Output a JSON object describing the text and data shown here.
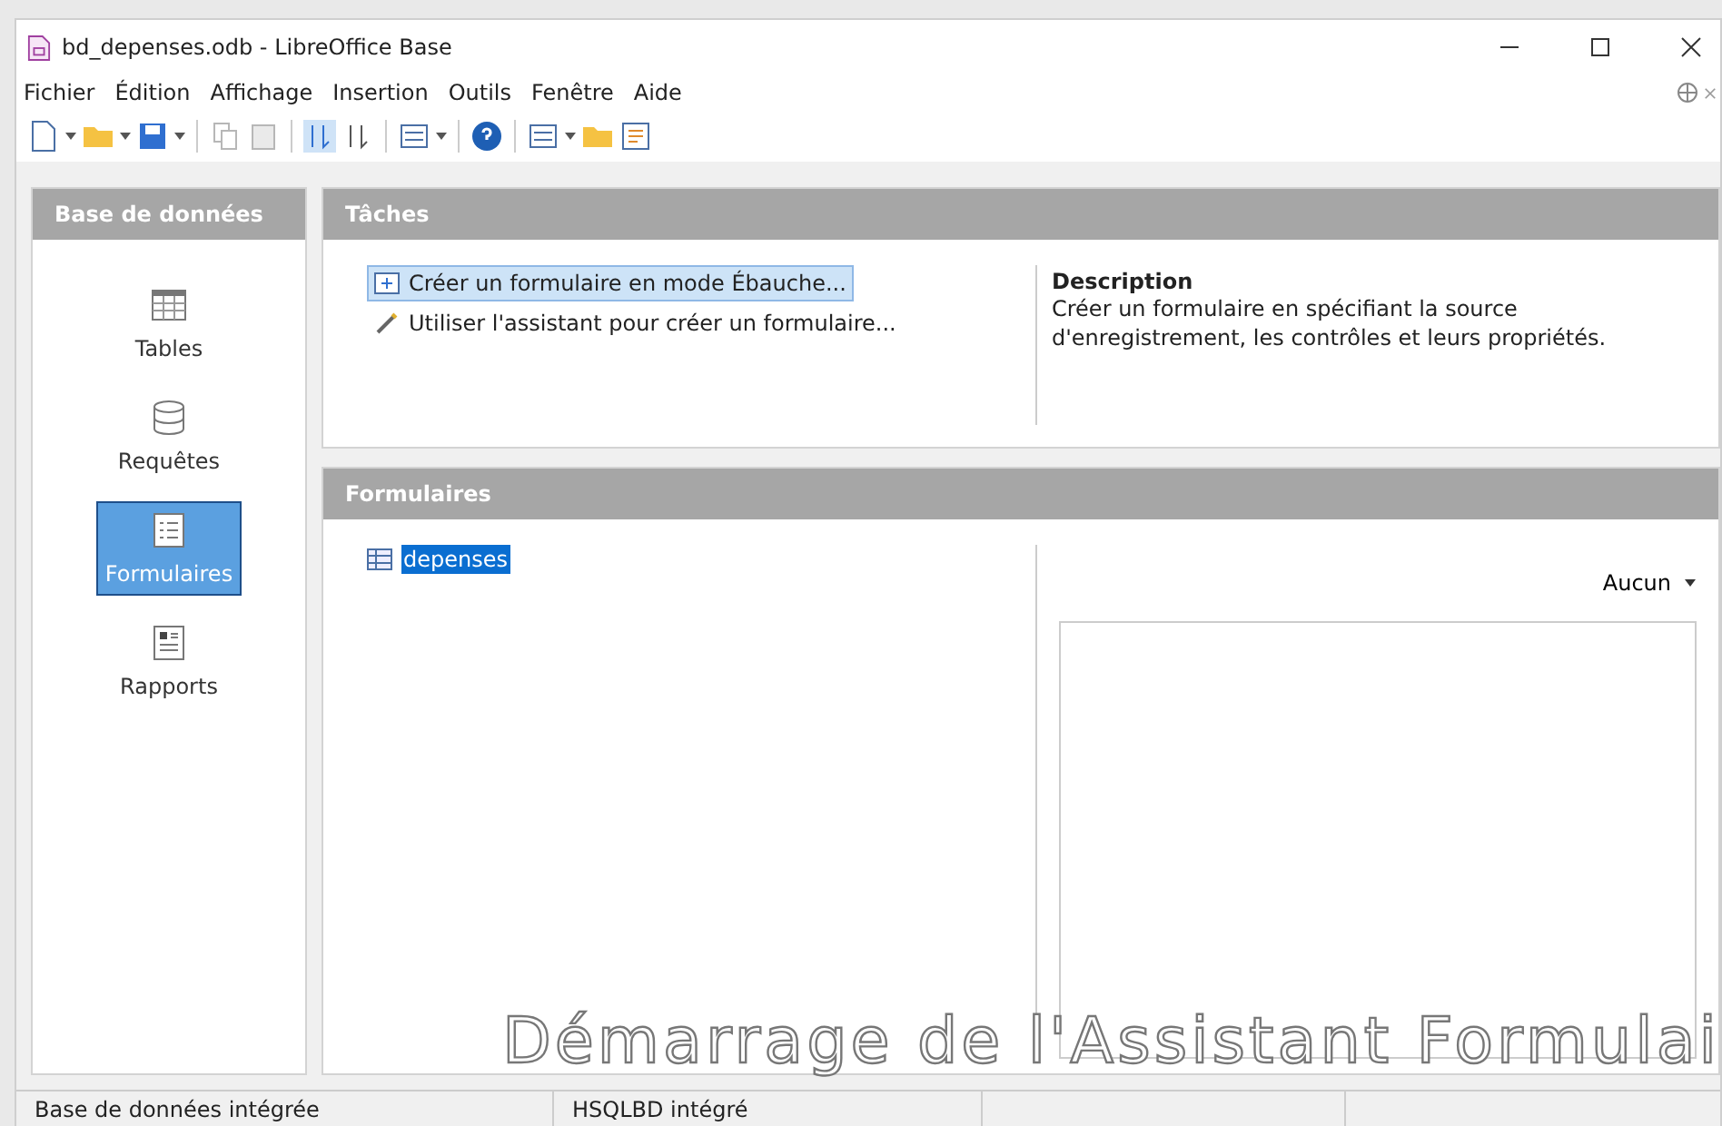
{
  "window": {
    "title": "bd_depenses.odb - LibreOffice Base"
  },
  "menu": [
    "Fichier",
    "Édition",
    "Affichage",
    "Insertion",
    "Outils",
    "Fenêtre",
    "Aide"
  ],
  "sidebar": {
    "title": "Base de données",
    "items": [
      {
        "label": "Tables",
        "kind": "table",
        "selected": false
      },
      {
        "label": "Requêtes",
        "kind": "query",
        "selected": false
      },
      {
        "label": "Formulaires",
        "kind": "form",
        "selected": true
      },
      {
        "label": "Rapports",
        "kind": "report",
        "selected": false
      }
    ]
  },
  "tasks": {
    "title": "Tâches",
    "items": [
      {
        "label": "Créer un formulaire en mode Ébauche...",
        "kind": "design",
        "selected": true
      },
      {
        "label": "Utiliser l'assistant pour créer un formulaire...",
        "kind": "wizard",
        "selected": false
      }
    ],
    "description_title": "Description",
    "description": "Créer un formulaire en spécifiant la source d'enregistrement, les contrôles et leurs propriétés."
  },
  "forms": {
    "title": "Formulaires",
    "items": [
      {
        "label": "depenses",
        "selected": true
      }
    ],
    "preview_choice": "Aucun"
  },
  "caption": "Démarrage de l'Assistant Formulai",
  "status_bar": [
    "Base de données intégrée",
    "HSQLBD intégré"
  ]
}
